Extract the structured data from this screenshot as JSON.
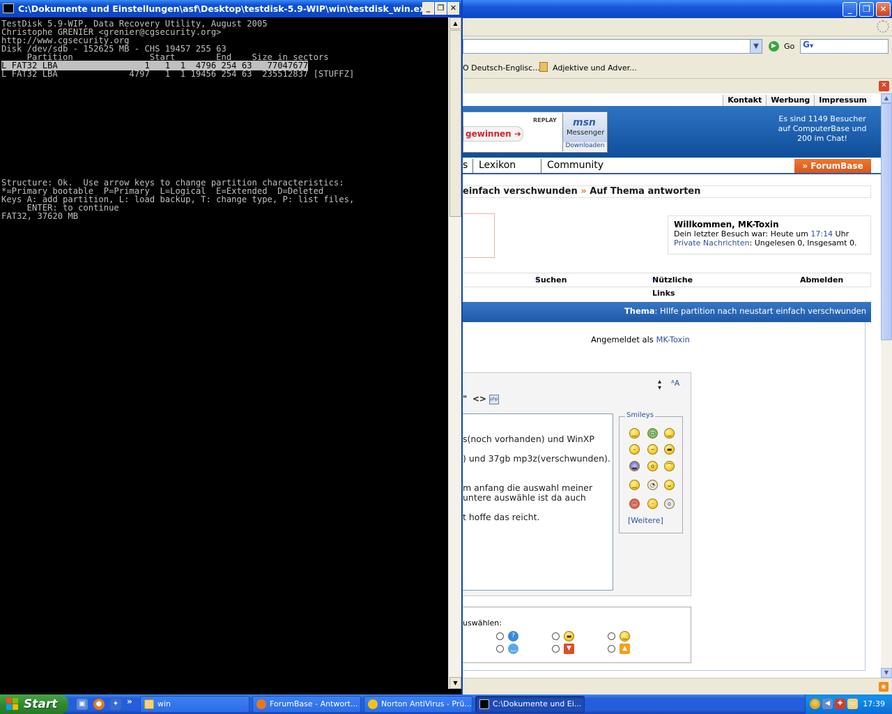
{
  "console": {
    "title": "C:\\Dokumente und Einstellungen\\asf\\Desktop\\testdisk-5.9-WIP\\win\\testdisk_win.exe",
    "lines": [
      "TestDisk 5.9-WIP, Data Recovery Utility, August 2005",
      "Christophe GRENIER <grenier@cgsecurity.org>",
      "http://www.cgsecurity.org",
      "",
      "Disk /dev/sdb - 152625 MB - CHS 19457 255 63",
      "     Partition               Start        End    Size in sectors"
    ],
    "partition_selected": "L FAT32 LBA                 1   1  1  4796 254 63   77047677",
    "partition_2": "L FAT32 LBA              4797   1  1 19456 254 63  235512837 [STUFFZ]",
    "status_lines": [
      "Structure: Ok.  Use arrow keys to change partition characteristics:",
      "*=Primary bootable  P=Primary  L=Logical  E=Extended  D=Deleted",
      "Keys A: add partition, L: load backup, T: change type, P: list files,",
      "     ENTER: to continue",
      "FAT32, 37620 MB"
    ],
    "minimize": "_",
    "maximize": "❐",
    "close": "✕"
  },
  "browser": {
    "go_label": "Go",
    "links": [
      "O Deutsch-Englisc...",
      "Adjektive und Adver..."
    ],
    "topnav": [
      "Kontakt",
      "Werbung",
      "Impressum"
    ],
    "ad": {
      "gewinnen": "gewinnen ➔",
      "replay": "REPLAY",
      "msn": "msn",
      "messenger": "Messenger",
      "downloaden": "Downloaden"
    },
    "visitors": "Es sind 1149 Besucher auf ComputerBase und 200 im Chat!",
    "mainnav": [
      "s",
      "Lexikon",
      "Community"
    ],
    "forumbase": "» ForumBase",
    "breadcrumb": {
      "part1": "einfach verschwunden",
      "sep": " » ",
      "part2": "Auf Thema antworten"
    },
    "welcome": {
      "title": "Willkommen, MK-Toxin",
      "last_visit_prefix": "Dein letzter Besuch war: Heute um ",
      "last_visit_time": "17:14",
      "last_visit_suffix": " Uhr",
      "pm_link": "Private Nachrichten",
      "pm_text": ": Ungelesen 0, Insgesamt 0."
    },
    "subnav": [
      "Suchen",
      "Nützliche Links",
      "Abmelden"
    ],
    "thread_label": "Thema",
    "thread_title": ": HIlfe partition nach neustart einfach verschwunden",
    "logged_in_prefix": "Angemeldet als ",
    "logged_in_user": "MK-Toxin",
    "post_lines": [
      "s(noch vorhanden) und WinXP",
      ") und 37gb mp3z(verschwunden).",
      "m anfang die auswahl meiner",
      "untere auswähle ist da auch",
      "t hoffe das reicht."
    ],
    "smileys_label": "Smileys",
    "weitere": "[Weitere]",
    "icon_label": "uswählen:"
  },
  "taskbar": {
    "start": "Start",
    "tasks": [
      "win",
      "ForumBase - Antwort...",
      "Norton AntiVirus - Prü...",
      "C:\\Dokumente und Ei..."
    ],
    "more": "»",
    "clock": "17:39"
  }
}
